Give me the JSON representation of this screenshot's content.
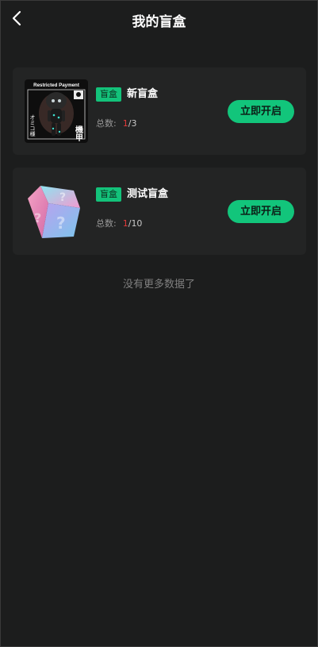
{
  "header": {
    "title": "我的盲盒",
    "back_icon": "chevron-left-icon"
  },
  "colors": {
    "background": "#1c1d1d",
    "card": "#232424",
    "accent": "#12c57b",
    "count_current": "#e03a3a"
  },
  "boxes": [
    {
      "tag": "盲盒",
      "name": "新盲盒",
      "count_label": "总数:",
      "current": "1",
      "separator": "/",
      "total": "3",
      "button_label": "立即开启",
      "image": {
        "caption": "Restricted Payment",
        "vertical_text": "オミコ様",
        "side_text": "機甲"
      }
    },
    {
      "tag": "盲盒",
      "name": "测试盲盒",
      "count_label": "总数:",
      "current": "1",
      "separator": "/",
      "total": "10",
      "button_label": "立即开启"
    }
  ],
  "footer_text": "没有更多数据了"
}
